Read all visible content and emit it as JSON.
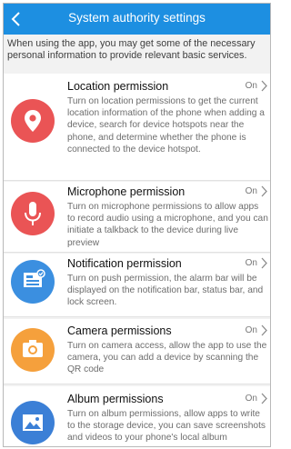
{
  "header": {
    "title": "System authority settings"
  },
  "intro": "When using the app, you may get some of the necessary personal information to provide relevant basic services.",
  "colors": {
    "header": "#1d8fe1",
    "location": "#ea5455",
    "microphone": "#ea5455",
    "notification": "#3b8fe0",
    "camera": "#f5a03c",
    "album": "#3b7fd6"
  },
  "items": [
    {
      "name": "Location permission",
      "status": "On",
      "icon": "location-pin-icon",
      "desc": "Turn on location permissions to get the current location information of the phone when adding a device, search for device hotspots near the phone, and determine whether the phone is connected to the device hotspot."
    },
    {
      "name": "Microphone permission",
      "status": "On",
      "icon": "microphone-icon",
      "desc": "Turn on microphone permissions to allow apps to record audio using a microphone, and you can initiate a talkback to the device during live preview"
    },
    {
      "name": "Notification permission",
      "status": "On",
      "icon": "notification-icon",
      "desc": "Turn on push permission, the alarm bar will be displayed on the notification bar, status bar, and lock screen."
    },
    {
      "name": "Camera permissions",
      "status": "On",
      "icon": "camera-icon",
      "desc": "Turn on camera access, allow the app to use the camera, you can add a device by scanning the QR code"
    },
    {
      "name": "Album permissions",
      "status": "On",
      "icon": "album-icon",
      "desc": "Turn on album permissions, allow apps to write to the storage device, you can save screenshots and videos to your phone's local album"
    }
  ]
}
